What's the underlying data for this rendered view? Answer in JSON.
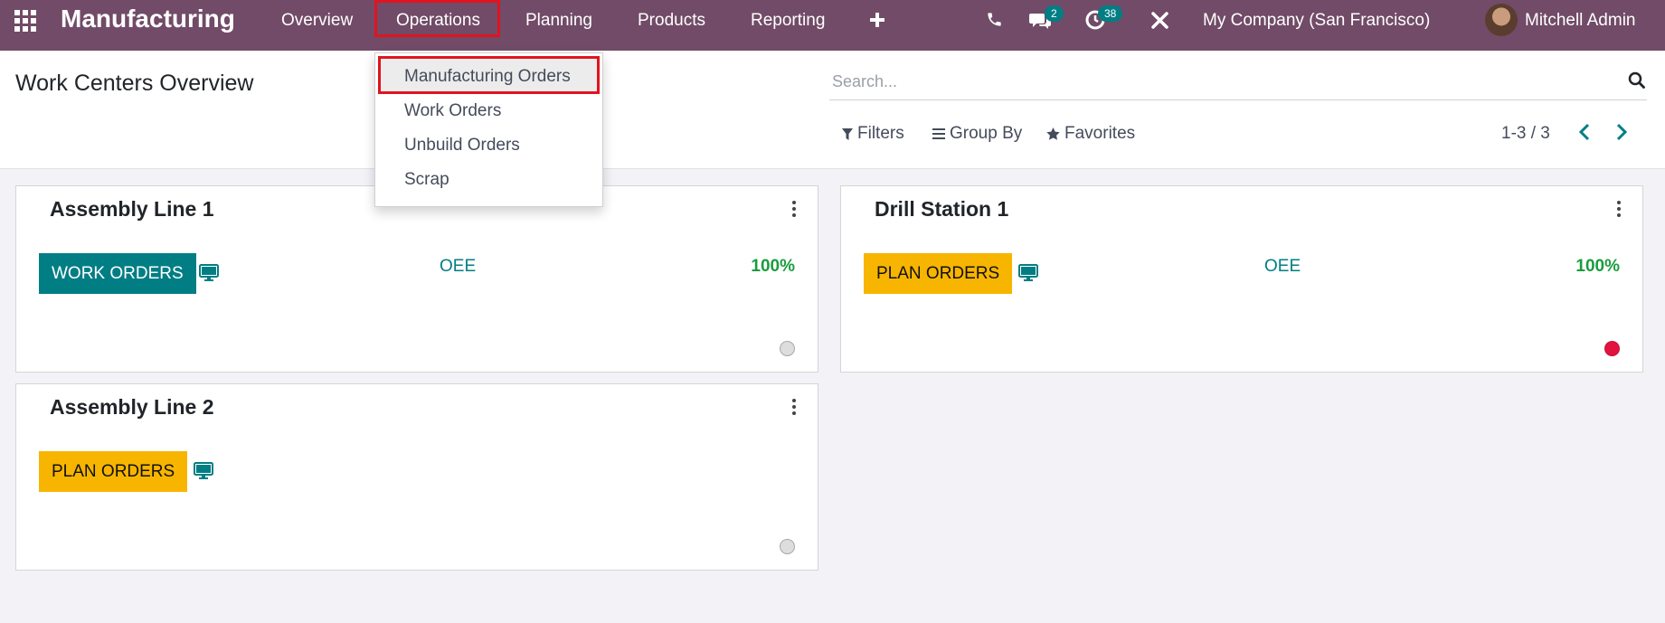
{
  "navbar": {
    "brand": "Manufacturing",
    "menu": [
      "Overview",
      "Operations",
      "Planning",
      "Products",
      "Reporting"
    ],
    "plus_icon": "plus-icon",
    "messages_badge": "2",
    "activities_badge": "38",
    "company": "My Company (San Francisco)",
    "user": "Mitchell Admin"
  },
  "operations_menu": {
    "items": [
      "Manufacturing Orders",
      "Work Orders",
      "Unbuild Orders",
      "Scrap"
    ],
    "highlighted": "Manufacturing Orders"
  },
  "control_panel": {
    "title": "Work Centers Overview",
    "search_placeholder": "Search...",
    "filters": "Filters",
    "group_by": "Group By",
    "favorites": "Favorites",
    "pager": "1-3 / 3"
  },
  "cards": [
    {
      "title": "Assembly Line 1",
      "button": "WORK ORDERS",
      "button_style": "teal",
      "oee_label": "OEE",
      "oee_value": "100%",
      "status_color": "#dddddd"
    },
    {
      "title": "Drill Station 1",
      "button": "PLAN ORDERS",
      "button_style": "yellow",
      "oee_label": "OEE",
      "oee_value": "100%",
      "status_color": "#e2133f"
    },
    {
      "title": "Assembly Line 2",
      "button": "PLAN ORDERS",
      "button_style": "yellow",
      "status_color": "#dddddd"
    }
  ],
  "colors": {
    "navbar": "#714b67",
    "accent": "#017e84",
    "warning": "#f8b500",
    "success": "#1a9c3e",
    "danger": "#e2133f",
    "highlight_border": "#e0141e"
  }
}
